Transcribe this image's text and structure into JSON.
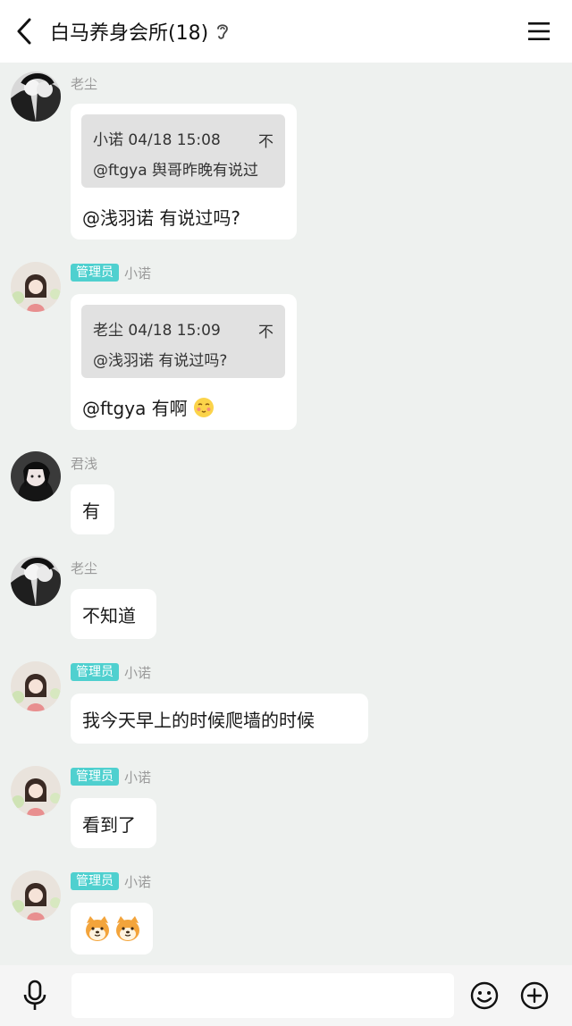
{
  "header": {
    "title": "白马养身会所(18)",
    "icons": [
      "back-arrow-icon",
      "ear-icon",
      "menu-icon"
    ]
  },
  "messages": [
    {
      "sender": "老尘",
      "is_admin": false,
      "quote": {
        "author_time": "小诺 04/18 15:08",
        "pin_glyph": "不",
        "text": "@ftgya 舆哥昨晚有说过"
      },
      "text": "@浅羽诺 有说过吗?"
    },
    {
      "sender": "小诺",
      "is_admin": true,
      "admin_label": "管理员",
      "quote": {
        "author_time": "老尘 04/18 15:09",
        "pin_glyph": "不",
        "text": "@浅羽诺 有说过吗?"
      },
      "text": "@ftgya 有啊"
    },
    {
      "sender": "君浅",
      "is_admin": false,
      "text": "有"
    },
    {
      "sender": "老尘",
      "is_admin": false,
      "text": "不知道"
    },
    {
      "sender": "小诺",
      "is_admin": true,
      "admin_label": "管理员",
      "text": "我今天早上的时候爬墙的时候"
    },
    {
      "sender": "小诺",
      "is_admin": true,
      "admin_label": "管理员",
      "text": "看到了"
    },
    {
      "sender": "小诺",
      "is_admin": true,
      "admin_label": "管理员",
      "text": "",
      "stickers": [
        "shiba-emoji",
        "shiba-emoji"
      ]
    }
  ],
  "composer": {
    "placeholder": "",
    "icons": [
      "microphone-icon",
      "emoji-icon",
      "plus-icon"
    ]
  },
  "colors": {
    "background": "#eef1ef",
    "bubble": "#ffffff",
    "admin_badge": "#4fd0cf",
    "quote_bg": "#e1e1e1"
  }
}
